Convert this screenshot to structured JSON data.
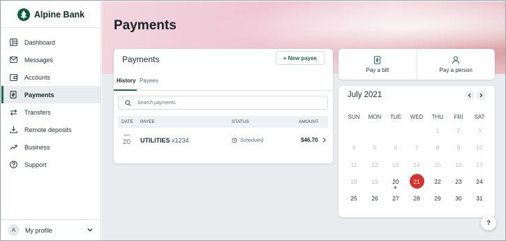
{
  "brand": {
    "name": "Alpine Bank",
    "accent": "#0d5b3a"
  },
  "sidebar": {
    "items": [
      {
        "label": "Dashboard",
        "icon": "dashboard-icon",
        "active": false
      },
      {
        "label": "Messages",
        "icon": "mail-icon",
        "active": false
      },
      {
        "label": "Accounts",
        "icon": "wallet-icon",
        "active": false
      },
      {
        "label": "Payments",
        "icon": "bill-icon",
        "active": true
      },
      {
        "label": "Transfers",
        "icon": "transfer-icon",
        "active": false
      },
      {
        "label": "Remote deposits",
        "icon": "download-icon",
        "active": false
      },
      {
        "label": "Business",
        "icon": "trend-icon",
        "active": false
      },
      {
        "label": "Support",
        "icon": "help-circle-icon",
        "active": false
      }
    ],
    "profile": {
      "initial": "A",
      "label": "My profile"
    }
  },
  "page": {
    "title": "Payments"
  },
  "payments_card": {
    "title": "Payments",
    "new_payee_label": "+ New payee",
    "tabs": [
      "History",
      "Payees"
    ],
    "active_tab": "History",
    "search_placeholder": "Search payments",
    "columns": [
      "DATE",
      "PAYEE",
      "STATUS",
      "AMOUNT"
    ],
    "rows": [
      {
        "month": "AUG",
        "day": "20",
        "payee": "UTILITIES",
        "account": "x1234",
        "status": "Scheduled",
        "amount": "$46.70"
      }
    ]
  },
  "quick_actions": [
    {
      "label": "Pay a bill",
      "icon": "bill-icon"
    },
    {
      "label": "Pay a person",
      "icon": "person-icon"
    }
  ],
  "calendar": {
    "month_label": "July 2021",
    "weekdays": [
      "SUN",
      "MON",
      "TUE",
      "WED",
      "THU",
      "FRI",
      "SAT"
    ],
    "weeks": [
      [
        "",
        "",
        "",
        "",
        "1",
        "2",
        "3"
      ],
      [
        "4",
        "5",
        "6",
        "7",
        "8",
        "9",
        "10"
      ],
      [
        "11",
        "12",
        "13",
        "14",
        "15",
        "16",
        "17"
      ],
      [
        "18",
        "19",
        "20",
        "21",
        "22",
        "23",
        "24"
      ],
      [
        "25",
        "26",
        "27",
        "28",
        "29",
        "30",
        "31"
      ]
    ],
    "today": "20",
    "selected": "21",
    "first_available": "20",
    "selected_color": "#d6312b"
  },
  "help_label": "?"
}
